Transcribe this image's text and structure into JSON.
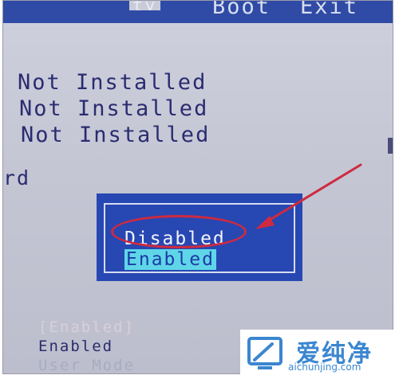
{
  "menu": {
    "left_fragment": "ty",
    "boot": "Boot",
    "exit": "Exit"
  },
  "status_list": [
    "Not Installed",
    "Not Installed",
    "Not Installed"
  ],
  "side_label_fragment": "rd",
  "popup": {
    "options": [
      "Disabled",
      "Enabled"
    ],
    "highlighted": "Enabled",
    "circled": "Disabled"
  },
  "bottom_values": [
    "[Enabled]",
    "Enabled",
    "User Mode"
  ],
  "watermark": {
    "title": "爱纯净",
    "domain": "aichunjing.com",
    "logo_icon": "screen-icon"
  },
  "colors": {
    "menu_bar": "#2f4ba6",
    "screen_bg": "#c4c6d4",
    "popup_bg": "#2747b3",
    "highlight": "#5fd6e8",
    "annotation": "#cf2a3f",
    "watermark": "#3b86d0"
  }
}
